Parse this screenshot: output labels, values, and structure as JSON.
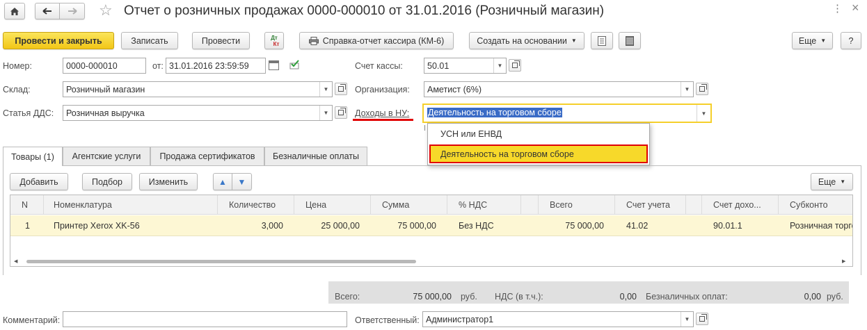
{
  "window": {
    "title": "Отчет о розничных продажах 0000-000010 от 31.01.2016 (Розничный магазин)",
    "more_dots": "⋮",
    "close_glyph": "×"
  },
  "toolbar": {
    "post_close": "Провести и закрыть",
    "save": "Записать",
    "post": "Провести",
    "dtkt_top": "Дт",
    "dtkt_bottom": "Кт",
    "cashier_report": "Справка-отчет кассира (КМ-6)",
    "create_based_on": "Создать на основании",
    "more": "Еще",
    "help": "?"
  },
  "form": {
    "number_label": "Номер:",
    "number_value": "0000-000010",
    "date_label": "от:",
    "date_value": "31.01.2016 23:59:59",
    "cash_account_label": "Счет кассы:",
    "cash_account_value": "50.01",
    "warehouse_label": "Склад:",
    "warehouse_value": "Розничный магазин",
    "organization_label": "Организация:",
    "organization_value": "Аметист (6%)",
    "cashflow_label": "Статья ДДС:",
    "cashflow_value": "Розничная выручка",
    "income_label": "Доходы в НУ:",
    "income_value": "Деятельность на торговом сборе"
  },
  "dropdown": {
    "options": [
      "УСН или ЕНВД",
      "Деятельность на торговом сборе"
    ],
    "selected_index": 1
  },
  "tabs": [
    "Товары (1)",
    "Агентские услуги",
    "Продажа сертификатов",
    "Безналичные оплаты"
  ],
  "table_toolbar": {
    "add": "Добавить",
    "select": "Подбор",
    "change": "Изменить",
    "more": "Еще"
  },
  "table": {
    "columns": [
      "N",
      "Номенклатура",
      "Количество",
      "Цена",
      "Сумма",
      "% НДС",
      "Всего",
      "Счет учета",
      "Счет дохо...",
      "Субконто"
    ],
    "rows": [
      [
        "1",
        "Принтер Xerox XK-56",
        "3,000",
        "25 000,00",
        "75 000,00",
        "Без НДС",
        "75 000,00",
        "41.02",
        "90.01.1",
        "Розничная торговля"
      ]
    ]
  },
  "totals": {
    "total_label": "Всего:",
    "total_value": "75 000,00",
    "total_currency": "руб.",
    "vat_label": "НДС (в т.ч.):",
    "vat_value": "0,00",
    "noncash_label": "Безналичных оплат:",
    "noncash_value": "0,00",
    "noncash_currency": "руб."
  },
  "footer": {
    "comment_label": "Комментарий:",
    "comment_value": "",
    "responsible_label": "Ответственный:",
    "responsible_value": "Администратор1"
  },
  "colors": {
    "primary_button": "#f5d02b",
    "dropdown_highlight": "#f7d92a",
    "dropdown_border": "#e00000",
    "row_highlight": "#fdf7d4",
    "selection": "#3a6bc6",
    "underline": "#e00000"
  }
}
